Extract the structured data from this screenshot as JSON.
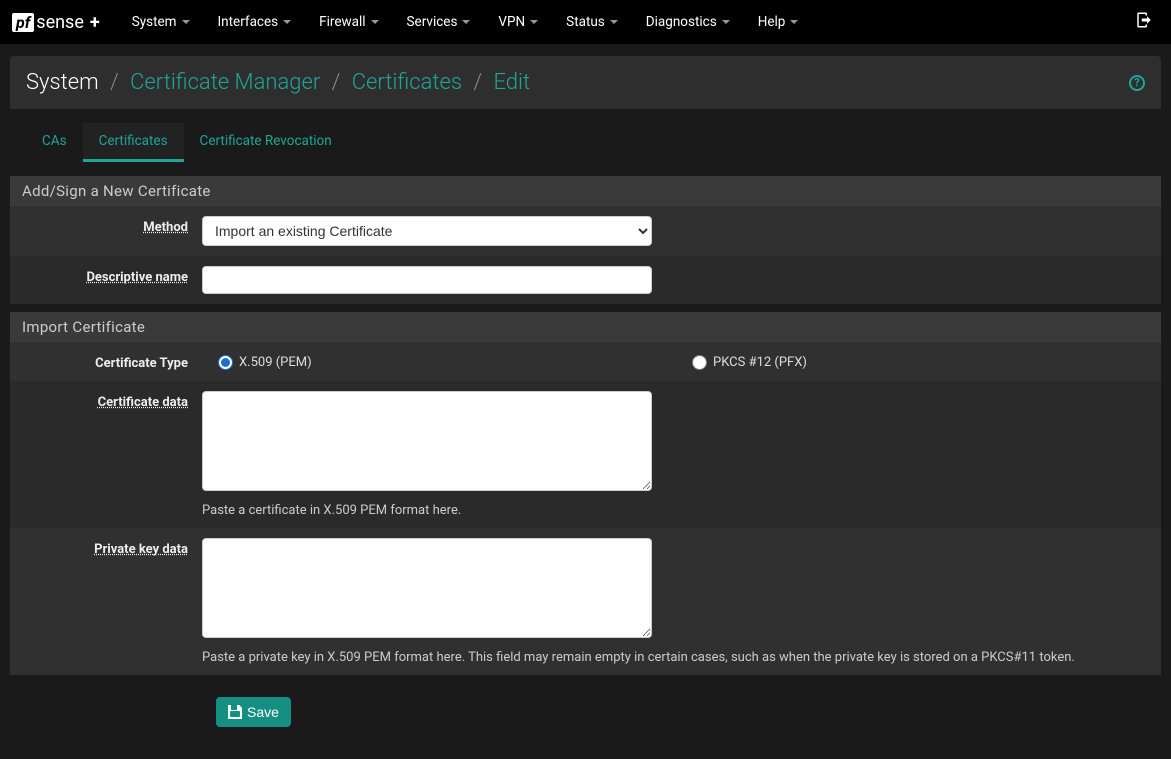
{
  "logo": {
    "pf": "pf",
    "sense": "sense",
    "plus": "+"
  },
  "nav": {
    "items": [
      {
        "label": "System"
      },
      {
        "label": "Interfaces"
      },
      {
        "label": "Firewall"
      },
      {
        "label": "Services"
      },
      {
        "label": "VPN"
      },
      {
        "label": "Status"
      },
      {
        "label": "Diagnostics"
      },
      {
        "label": "Help"
      }
    ]
  },
  "breadcrumb": {
    "a": "System",
    "b": "Certificate Manager",
    "c": "Certificates",
    "d": "Edit"
  },
  "tabs": {
    "cas": "CAs",
    "certs": "Certificates",
    "crl": "Certificate Revocation"
  },
  "panels": {
    "addsign": {
      "title": "Add/Sign a New Certificate",
      "method_label": "Method",
      "method_value": "Import an existing Certificate",
      "name_label": "Descriptive name",
      "name_value": ""
    },
    "import": {
      "title": "Import Certificate",
      "type_label": "Certificate Type",
      "radio_pem": "X.509 (PEM)",
      "radio_pfx": "PKCS #12 (PFX)",
      "certdata_label": "Certificate data",
      "certdata_value": "",
      "certdata_help": "Paste a certificate in X.509 PEM format here.",
      "keydata_label": "Private key data",
      "keydata_value": "",
      "keydata_help": "Paste a private key in X.509 PEM format here. This field may remain empty in certain cases, such as when the private key is stored on a PKCS#11 token."
    }
  },
  "actions": {
    "save": "Save"
  }
}
